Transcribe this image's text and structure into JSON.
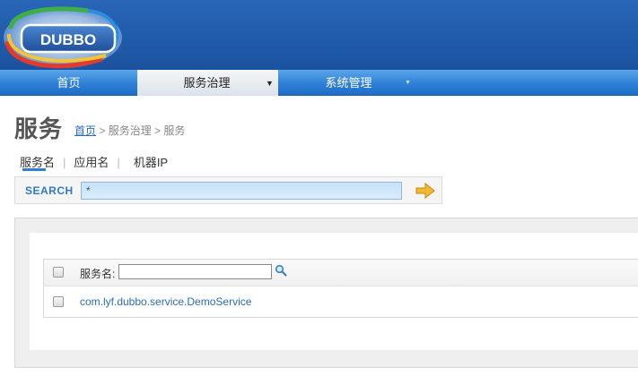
{
  "header": {
    "logo_text": "DUBBO"
  },
  "nav": {
    "items": [
      {
        "label": "首页"
      },
      {
        "label": "服务治理",
        "arrow": "▼"
      },
      {
        "label": "系统管理",
        "arrow": "▼"
      }
    ]
  },
  "page": {
    "title": "服务",
    "breadcrumb": {
      "home": "首页",
      "sep1": " > ",
      "governance": "服务治理",
      "sep2": " > ",
      "current": "服务"
    }
  },
  "tabs": {
    "items": [
      {
        "label": "服务名"
      },
      {
        "label": "应用名"
      },
      {
        "label": "机器IP"
      }
    ],
    "separator": "|"
  },
  "search": {
    "label": "SEARCH",
    "value": "*"
  },
  "table": {
    "filter_label": "服务名:",
    "filter_value": "",
    "rows": [
      {
        "service": "com.lyf.dubbo.service.DemoService"
      }
    ]
  },
  "colors": {
    "header_blue": "#1f5aa8",
    "nav_blue": "#2f80d6",
    "link_blue": "#2a6db5",
    "search_label": "#2f7ac7",
    "go_arrow": "#f2b733"
  }
}
